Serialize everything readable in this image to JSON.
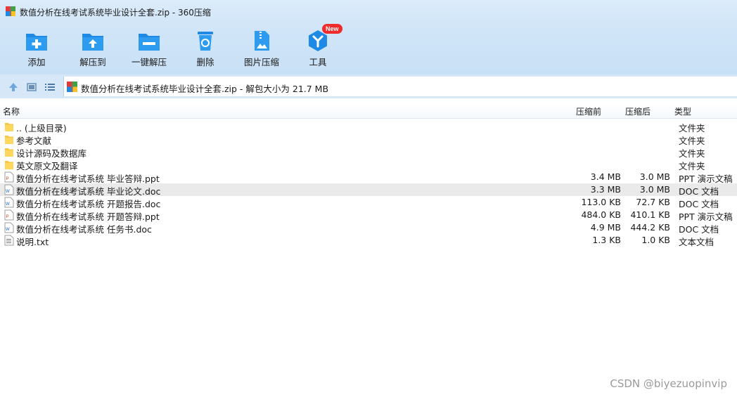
{
  "window": {
    "title": "数值分析在线考试系统毕业设计全套.zip - 360压缩"
  },
  "toolbar": {
    "add": "添加",
    "extract_to": "解压到",
    "one_click_extract": "一键解压",
    "delete": "删除",
    "image_compress": "图片压缩",
    "tools": "工具",
    "tools_badge": "New"
  },
  "address": {
    "text": "数值分析在线考试系统毕业设计全套.zip - 解包大小为 21.7 MB"
  },
  "columns": {
    "name": "名称",
    "size": "压缩前",
    "packed": "压缩后",
    "type": "类型"
  },
  "files": [
    {
      "name": ".. (上级目录)",
      "size": "",
      "packed": "",
      "type": "文件夹",
      "icon": "folder-icon"
    },
    {
      "name": "参考文献",
      "size": "",
      "packed": "",
      "type": "文件夹",
      "icon": "folder-icon"
    },
    {
      "name": "设计源码及数据库",
      "size": "",
      "packed": "",
      "type": "文件夹",
      "icon": "folder-icon"
    },
    {
      "name": "英文原文及翻译",
      "size": "",
      "packed": "",
      "type": "文件夹",
      "icon": "folder-icon"
    },
    {
      "name": "数值分析在线考试系统 毕业答辩.ppt",
      "size": "3.4 MB",
      "packed": "3.0 MB",
      "type": "PPT 演示文稿",
      "icon": "ppt-icon"
    },
    {
      "name": "数值分析在线考试系统 毕业论文.doc",
      "size": "3.3 MB",
      "packed": "3.0 MB",
      "type": "DOC 文档",
      "icon": "doc-icon"
    },
    {
      "name": "数值分析在线考试系统 开题报告.doc",
      "size": "113.0 KB",
      "packed": "72.7 KB",
      "type": "DOC 文档",
      "icon": "doc-icon"
    },
    {
      "name": "数值分析在线考试系统 开题答辩.ppt",
      "size": "484.0 KB",
      "packed": "410.1 KB",
      "type": "PPT 演示文稿",
      "icon": "ppt-icon"
    },
    {
      "name": "数值分析在线考试系统 任务书.doc",
      "size": "4.9 MB",
      "packed": "444.2 KB",
      "type": "DOC 文档",
      "icon": "doc-icon"
    },
    {
      "name": "说明.txt",
      "size": "1.3 KB",
      "packed": "1.0 KB",
      "type": "文本文档",
      "icon": "txt-icon"
    }
  ],
  "watermark": "CSDN @biyezuopinvip",
  "colors": {
    "accent": "#1e8ae6",
    "toolbar_bg": "#d2e6f8",
    "selected_row": "#eaeaea",
    "folder": "#f6c945"
  }
}
